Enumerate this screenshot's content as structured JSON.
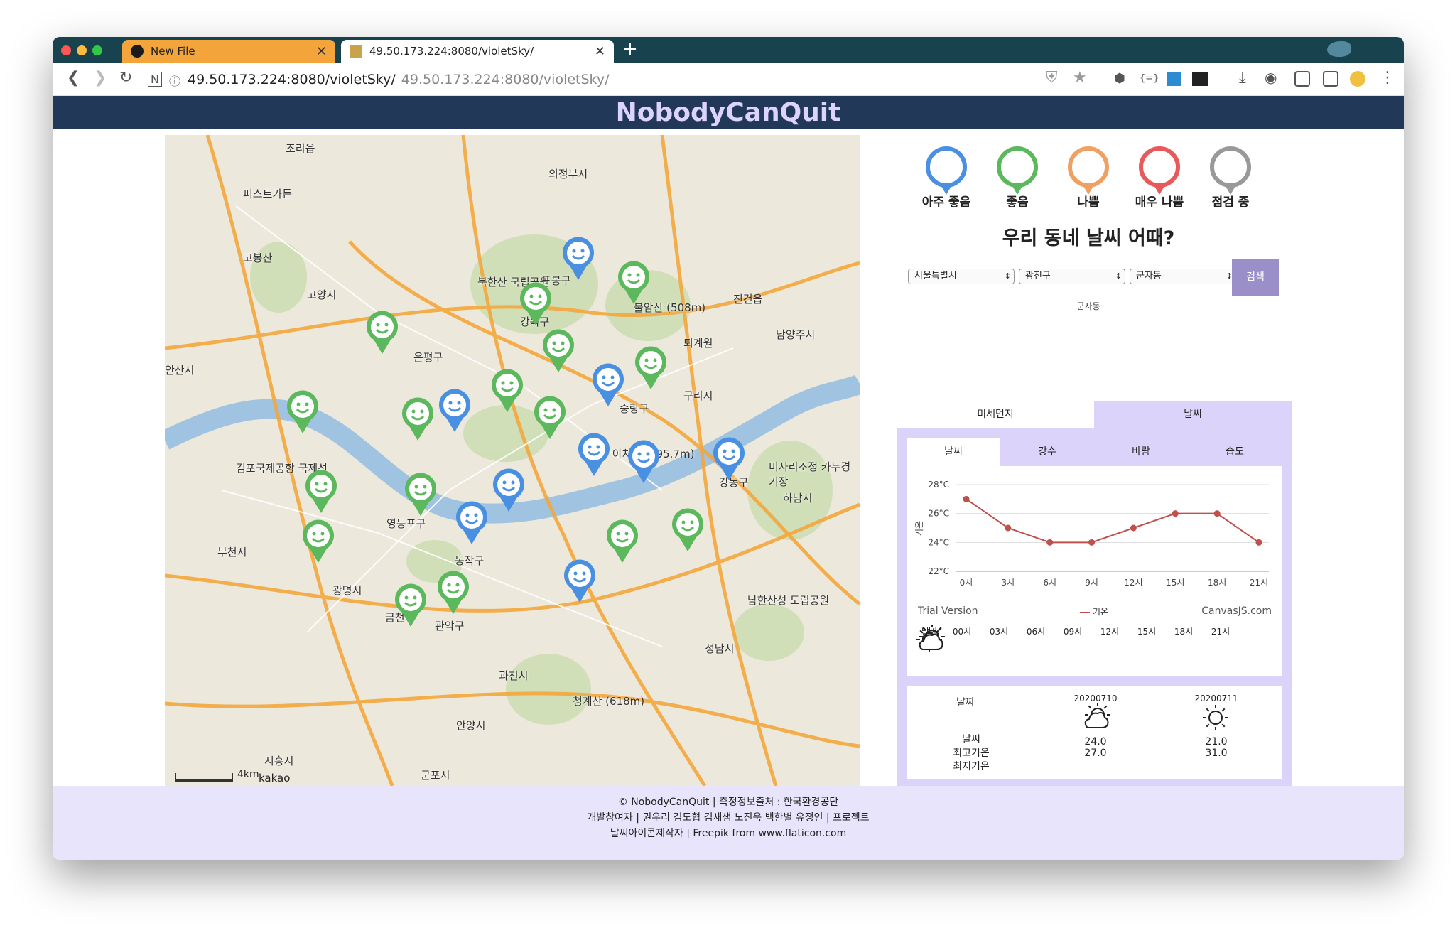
{
  "browser": {
    "tabs": [
      {
        "title": "New File",
        "close": "✕"
      },
      {
        "title": "49.50.173.224:8080/violetSky/",
        "close": "✕"
      }
    ],
    "new_tab": "+",
    "url_host": "49.50.173.224:8080/violetSky/",
    "url_suffix": "49.50.173.224:8080/violetSky/"
  },
  "header": {
    "title": "NobodyCanQuit"
  },
  "map": {
    "scale": "4km",
    "provider": "kakao",
    "labels": [
      "조리읍",
      "의정부시",
      "퍼스트가든",
      "고봉산",
      "고양시",
      "은평구",
      "북한산 국립공원",
      "도봉구",
      "강북구",
      "불암산 (508m)",
      "남양주시",
      "진건읍",
      "퇴계원",
      "구리시",
      "중랑구",
      "김포국제공항 국제선",
      "영등포구",
      "동작구",
      "아차산 (295.7m)",
      "강동구",
      "하남시",
      "미사리조정 카누경기장",
      "부천시",
      "광명시",
      "금천구",
      "관악구",
      "과천시",
      "청계산 (618m)",
      "성남시",
      "남한산성 도립공원",
      "안양시",
      "시흥시",
      "군포시",
      "안산시"
    ]
  },
  "legend": [
    {
      "label": "아주 좋음",
      "color": "#4a90e2"
    },
    {
      "label": "좋음",
      "color": "#5cb85c"
    },
    {
      "label": "나쁨",
      "color": "#f0a060"
    },
    {
      "label": "매우 나쁨",
      "color": "#e85a5a"
    },
    {
      "label": "점검 중",
      "color": "#999999"
    }
  ],
  "question": "우리 동네 날씨 어때?",
  "search": {
    "city": "서울특별시",
    "district": "광진구",
    "dong": "군자동",
    "button": "검색",
    "selected": "군자동"
  },
  "panel": {
    "tabs": [
      "미세먼지",
      "날씨"
    ],
    "subtabs": [
      "날씨",
      "강수",
      "바람",
      "습도"
    ]
  },
  "chart_data": {
    "type": "line",
    "categories": [
      "0시",
      "3시",
      "6시",
      "9시",
      "12시",
      "15시",
      "18시",
      "21시"
    ],
    "series": [
      {
        "name": "기온",
        "values": [
          27,
          25,
          24,
          24,
          25,
          26,
          26,
          24
        ]
      }
    ],
    "ylabel": "기온",
    "ylim": [
      22,
      28
    ],
    "yticks": [
      "22°C",
      "24°C",
      "26°C",
      "28°C"
    ],
    "legend_position": "bottom",
    "watermark": "Trial Version",
    "credit": "CanvasJS.com"
  },
  "hourly": {
    "row_label": "날씨",
    "hours": [
      "00시",
      "03시",
      "06시",
      "09시",
      "12시",
      "15시",
      "18시",
      "21시"
    ],
    "icons": [
      "sun-icon",
      "sun-icon",
      "cloud-icon",
      "sun-cloud-icon",
      "sun-cloud-icon",
      "sun-cloud-icon",
      "sun-cloud-icon",
      "sun-cloud-icon"
    ]
  },
  "daily": {
    "date_header": "날짜",
    "weather_label": "날씨",
    "max_label": "최고기온",
    "min_label": "최저기온",
    "days": [
      {
        "date": "20200710",
        "icon": "sun-cloud-icon",
        "max": "24.0",
        "min": "27.0"
      },
      {
        "date": "20200711",
        "icon": "sun-icon",
        "max": "21.0",
        "min": "31.0"
      }
    ]
  },
  "footer": {
    "line1": "© NobodyCanQuit | 측정정보출처 : 한국환경공단",
    "line2": "개발참여자 | 권우리 김도협 김새샘 노진욱 백한별 유정인 | 프로젝트",
    "line3": "날씨아이콘제작자 | Freepik from www.flaticon.com"
  }
}
